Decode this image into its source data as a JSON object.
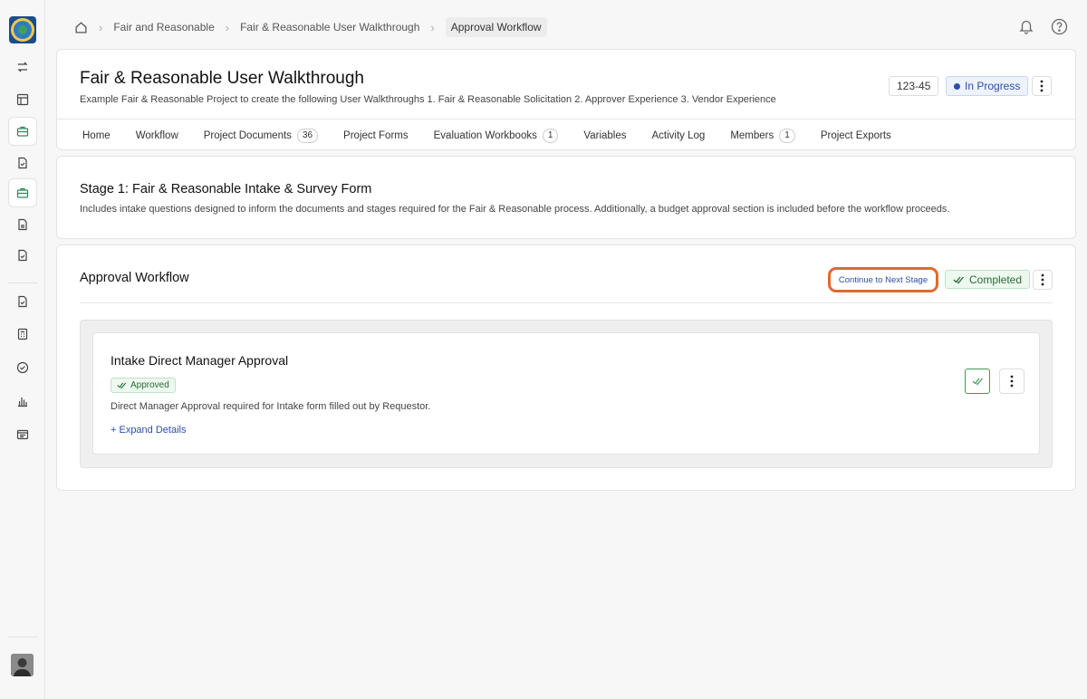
{
  "breadcrumb": {
    "items": [
      "Fair and Reasonable",
      "Fair & Reasonable User Walkthrough"
    ],
    "current": "Approval Workflow"
  },
  "project": {
    "title": "Fair & Reasonable User Walkthrough",
    "description": "Example Fair & Reasonable Project to create the following User Walkthroughs 1. Fair & Reasonable Solicitation 2. Approver Experience 3. Vendor Experience",
    "id": "123-45",
    "status": "In Progress"
  },
  "tabs": [
    {
      "label": "Home",
      "count": null
    },
    {
      "label": "Workflow",
      "count": null
    },
    {
      "label": "Project Documents",
      "count": "36"
    },
    {
      "label": "Project Forms",
      "count": null
    },
    {
      "label": "Evaluation Workbooks",
      "count": "1"
    },
    {
      "label": "Variables",
      "count": null
    },
    {
      "label": "Activity Log",
      "count": null
    },
    {
      "label": "Members",
      "count": "1"
    },
    {
      "label": "Project Exports",
      "count": null
    }
  ],
  "stage": {
    "title": "Stage 1: Fair & Reasonable Intake & Survey Form",
    "description": "Includes intake questions designed to inform the documents and stages required for the Fair & Reasonable process. Additionally, a budget approval section is included before the workflow proceeds."
  },
  "workflow": {
    "title": "Approval Workflow",
    "continue_label": "Continue to Next Stage",
    "status": "Completed"
  },
  "approval": {
    "title": "Intake Direct Manager Approval",
    "status": "Approved",
    "description": "Direct Manager Approval required for Intake form filled out by Requestor.",
    "expand_label": "+ Expand Details"
  },
  "colors": {
    "accent_blue": "#2c4ea8",
    "success_green": "#2a6a38",
    "highlight_orange": "#e06a2c"
  }
}
